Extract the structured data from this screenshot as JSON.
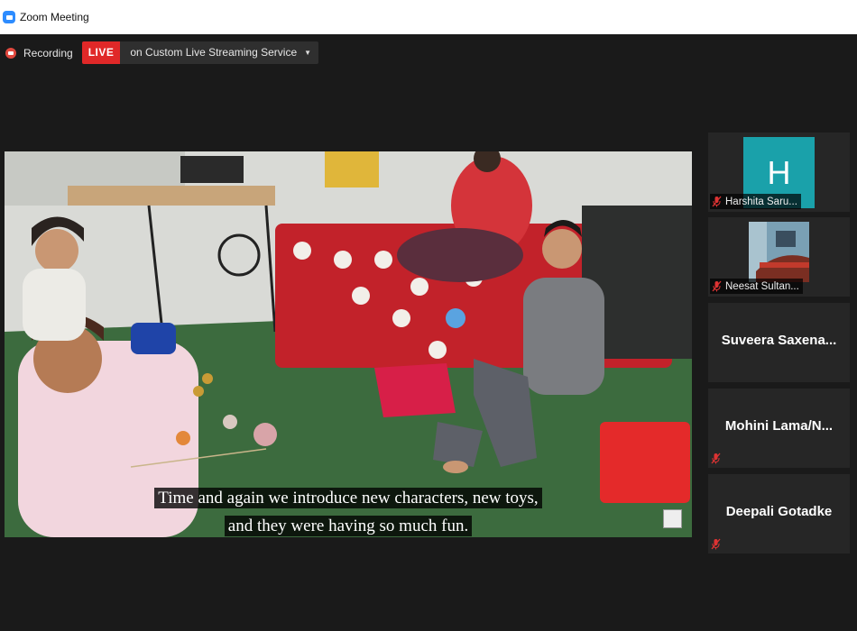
{
  "window": {
    "title": "Zoom Meeting",
    "app_icon": "zoom-camera-icon"
  },
  "recording": {
    "icon": "record-icon",
    "label": "Recording",
    "live_badge": "LIVE",
    "live_color": "#e02828",
    "stream_service": "on Custom Live Streaming Service",
    "dropdown_icon": "caret-down-icon"
  },
  "video": {
    "caption_line1": "Time and again we introduce new characters, new toys,",
    "caption_line2": "and they were having so much fun."
  },
  "participants": [
    {
      "name": "Harshita Saru...",
      "avatar_letter": "H",
      "avatar_color": "#1aa1aa",
      "muted": true
    },
    {
      "name": "Neesat Sultan...",
      "avatar": "photo",
      "muted": true
    },
    {
      "name": "Suveera  Saxena...",
      "muted": false
    },
    {
      "name": "Mohini  Lama/N...",
      "muted": true
    },
    {
      "name": "Deepali Gotadke",
      "muted": true
    }
  ]
}
